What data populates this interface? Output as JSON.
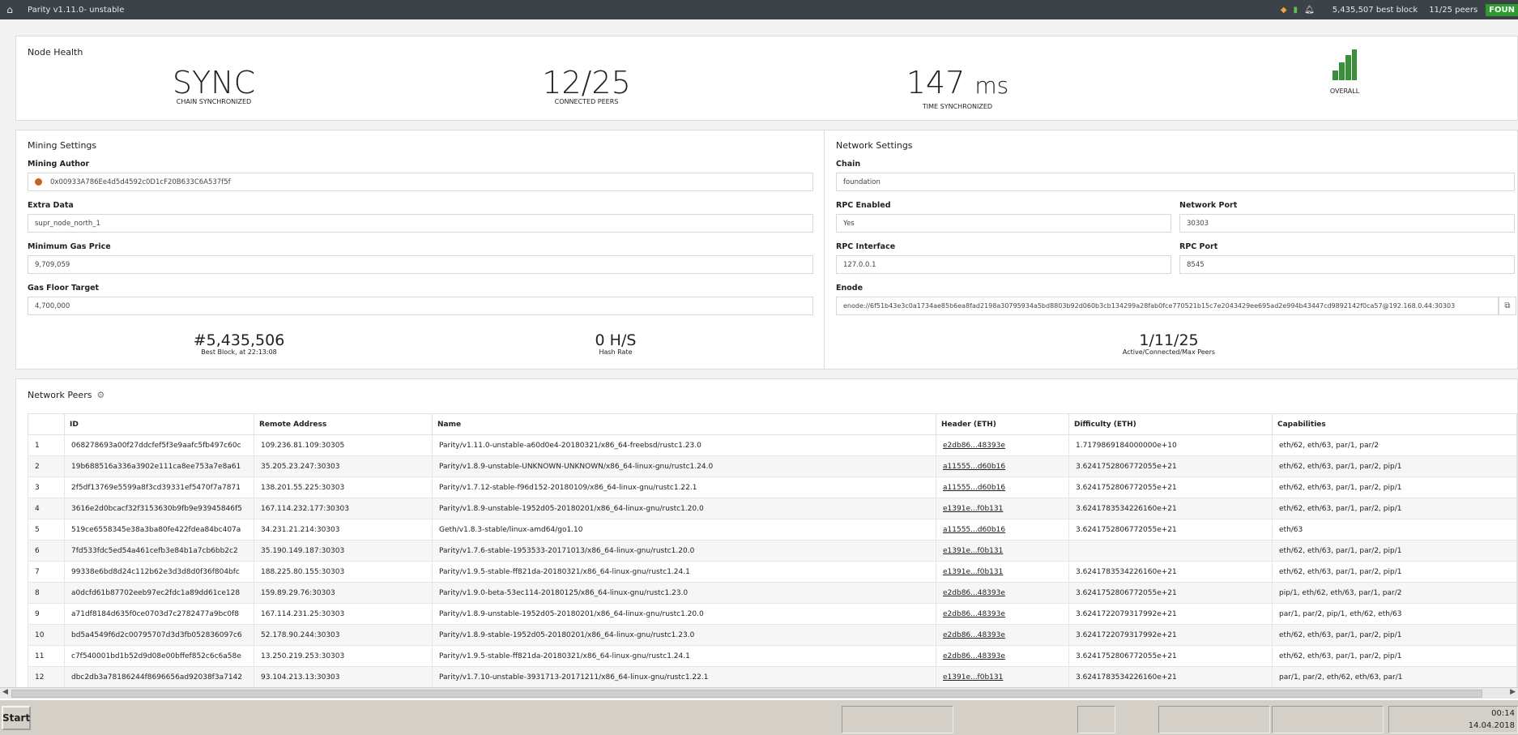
{
  "topbar": {
    "title": "Parity v1.11.0- unstable",
    "best_block": "5,435,507 best block",
    "peers": "11/25 peers",
    "status": "FOUN"
  },
  "health": {
    "title": "Node Health",
    "sync_value": "SYNC",
    "sync_label": "CHAIN SYNCHRONIZED",
    "peers_value": "12/25",
    "peers_label": "CONNECTED PEERS",
    "time_value": "147",
    "time_unit": "ms",
    "time_label": "TIME SYNCHRONIZED",
    "overall_label": "OVERALL"
  },
  "mining": {
    "title": "Mining Settings",
    "author_label": "Mining Author",
    "author_value": "0x00933A786Ee4d5d4592c0D1cF20B633C6A537f5f",
    "extra_label": "Extra Data",
    "extra_value": "supr_node_north_1",
    "gas_price_label": "Minimum Gas Price",
    "gas_price_value": "9,709,059",
    "gas_floor_label": "Gas Floor Target",
    "gas_floor_value": "4,700,000",
    "best_block_value": "#5,435,506",
    "best_block_desc": "Best Block, at 22:13:08",
    "hash_rate_value": "0 H/S",
    "hash_rate_desc": "Hash Rate"
  },
  "network": {
    "title": "Network Settings",
    "chain_label": "Chain",
    "chain_value": "foundation",
    "rpc_enabled_label": "RPC Enabled",
    "rpc_enabled_value": "Yes",
    "network_port_label": "Network Port",
    "network_port_value": "30303",
    "rpc_interface_label": "RPC Interface",
    "rpc_interface_value": "127.0.0.1",
    "rpc_port_label": "RPC Port",
    "rpc_port_value": "8545",
    "enode_label": "Enode",
    "enode_value": "enode://6f51b43e3c0a1734ae85b6ea8fad2198a30795934a5bd8803b92d060b3cb134299a28fab0fce770521b15c7e2043429ee695ad2e994b43447cd9892142f0ca57@192.168.0.44:30303",
    "peers_value": "1/11/25",
    "peers_desc": "Active/Connected/Max Peers"
  },
  "peers": {
    "title": "Network Peers",
    "columns": [
      "",
      "ID",
      "Remote Address",
      "Name",
      "Header (ETH)",
      "Difficulty (ETH)",
      "Capabilities"
    ],
    "rows": [
      [
        "1",
        "068278693a00f27ddcfef5f3e9aafc5fb497c60c",
        "109.236.81.109:30305",
        "Parity/v1.11.0-unstable-a60d0e4-20180321/x86_64-freebsd/rustc1.23.0",
        "e2db86...48393e",
        "1.7179869184000000e+10",
        "eth/62, eth/63, par/1, par/2"
      ],
      [
        "2",
        "19b688516a336a3902e111ca8ee753a7e8a61",
        "35.205.23.247:30303",
        "Parity/v1.8.9-unstable-UNKNOWN-UNKNOWN/x86_64-linux-gnu/rustc1.24.0",
        "a11555...d60b16",
        "3.6241752806772055e+21",
        "eth/62, eth/63, par/1, par/2, pip/1"
      ],
      [
        "3",
        "2f5df13769e5599a8f3cd39331ef5470f7a7871",
        "138.201.55.225:30303",
        "Parity/v1.7.12-stable-f96d152-20180109/x86_64-linux-gnu/rustc1.22.1",
        "a11555...d60b16",
        "3.6241752806772055e+21",
        "eth/62, eth/63, par/1, par/2, pip/1"
      ],
      [
        "4",
        "3616e2d0bcacf32f3153630b9fb9e93945846f5",
        "167.114.232.177:30303",
        "Parity/v1.8.9-unstable-1952d05-20180201/x86_64-linux-gnu/rustc1.20.0",
        "e1391e...f0b131",
        "3.6241783534226160e+21",
        "eth/62, eth/63, par/1, par/2, pip/1"
      ],
      [
        "5",
        "519ce6558345e38a3ba80fe422fdea84bc407a",
        "34.231.21.214:30303",
        "Geth/v1.8.3-stable/linux-amd64/go1.10",
        "a11555...d60b16",
        "3.6241752806772055e+21",
        "eth/63"
      ],
      [
        "6",
        "7fd533fdc5ed54a461cefb3e84b1a7cb6bb2c2",
        "35.190.149.187:30303",
        "Parity/v1.7.6-stable-1953533-20171013/x86_64-linux-gnu/rustc1.20.0",
        "e1391e...f0b131",
        "",
        "eth/62, eth/63, par/1, par/2, pip/1"
      ],
      [
        "7",
        "99338e6bd8d24c112b62e3d3d8d0f36f804bfc",
        "188.225.80.155:30303",
        "Parity/v1.9.5-stable-ff821da-20180321/x86_64-linux-gnu/rustc1.24.1",
        "e1391e...f0b131",
        "3.6241783534226160e+21",
        "eth/62, eth/63, par/1, par/2, pip/1"
      ],
      [
        "8",
        "a0dcfd61b87702eeb97ec2fdc1a89dd61ce128",
        "159.89.29.76:30303",
        "Parity/v1.9.0-beta-53ec114-20180125/x86_64-linux-gnu/rustc1.23.0",
        "e2db86...48393e",
        "3.6241752806772055e+21",
        "pip/1, eth/62, eth/63, par/1, par/2"
      ],
      [
        "9",
        "a71df8184d635f0ce0703d7c2782477a9bc0f8",
        "167.114.231.25:30303",
        "Parity/v1.8.9-unstable-1952d05-20180201/x86_64-linux-gnu/rustc1.20.0",
        "e2db86...48393e",
        "3.6241722079317992e+21",
        "par/1, par/2, pip/1, eth/62, eth/63"
      ],
      [
        "10",
        "bd5a4549f6d2c00795707d3d3fb052836097c6",
        "52.178.90.244:30303",
        "Parity/v1.8.9-stable-1952d05-20180201/x86_64-linux-gnu/rustc1.23.0",
        "e2db86...48393e",
        "3.6241722079317992e+21",
        "eth/62, eth/63, par/1, par/2, pip/1"
      ],
      [
        "11",
        "c7f540001bd1b52d9d08e00bffef852c6c6a58e",
        "13.250.219.253:30303",
        "Parity/v1.9.5-stable-ff821da-20180321/x86_64-linux-gnu/rustc1.24.1",
        "e2db86...48393e",
        "3.6241752806772055e+21",
        "eth/62, eth/63, par/1, par/2, pip/1"
      ],
      [
        "12",
        "dbc2db3a78186244f8696656ad92038f3a7142",
        "93.104.213.13:30303",
        "Parity/v1.7.10-unstable-3931713-20171211/x86_64-linux-gnu/rustc1.22.1",
        "e1391e...f0b131",
        "3.6241783534226160e+21",
        "par/1, par/2, eth/62, eth/63, par/1"
      ]
    ]
  },
  "taskbar": {
    "start": "Start",
    "time": "00:14",
    "date": "14.04.2018"
  },
  "colors": {
    "topbar": "#3b4248",
    "found": "#2e9b2e",
    "signal": "#3a8f3a"
  }
}
